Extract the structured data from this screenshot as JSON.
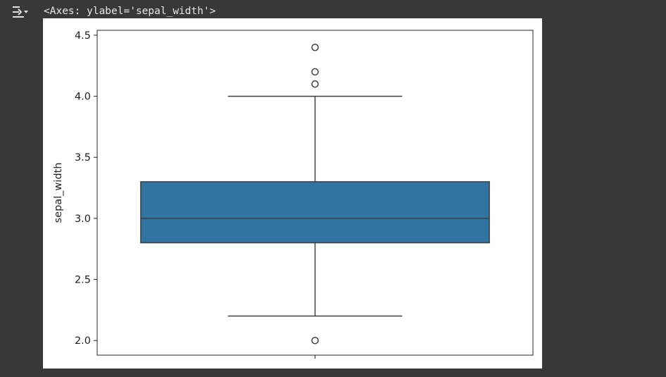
{
  "output": {
    "toggle_icon": "output-collapse-icon",
    "text": "<Axes: ylabel='sepal_width'>"
  },
  "chart_data": {
    "type": "box",
    "title": "",
    "xlabel": "",
    "ylabel": "sepal_width",
    "ylim": [
      1.88,
      4.54
    ],
    "yticks": [
      2.0,
      2.5,
      3.0,
      3.5,
      4.0,
      4.5
    ],
    "ytick_labels": [
      "2.0",
      "2.5",
      "3.0",
      "3.5",
      "4.0",
      "4.5"
    ],
    "box": {
      "q1": 2.8,
      "median": 3.0,
      "q3": 3.3,
      "whisker_low": 2.2,
      "whisker_high": 4.0,
      "color": "#3274a1"
    },
    "outliers": [
      4.4,
      4.2,
      4.1,
      2.0
    ],
    "grid": false,
    "legend": "none"
  }
}
